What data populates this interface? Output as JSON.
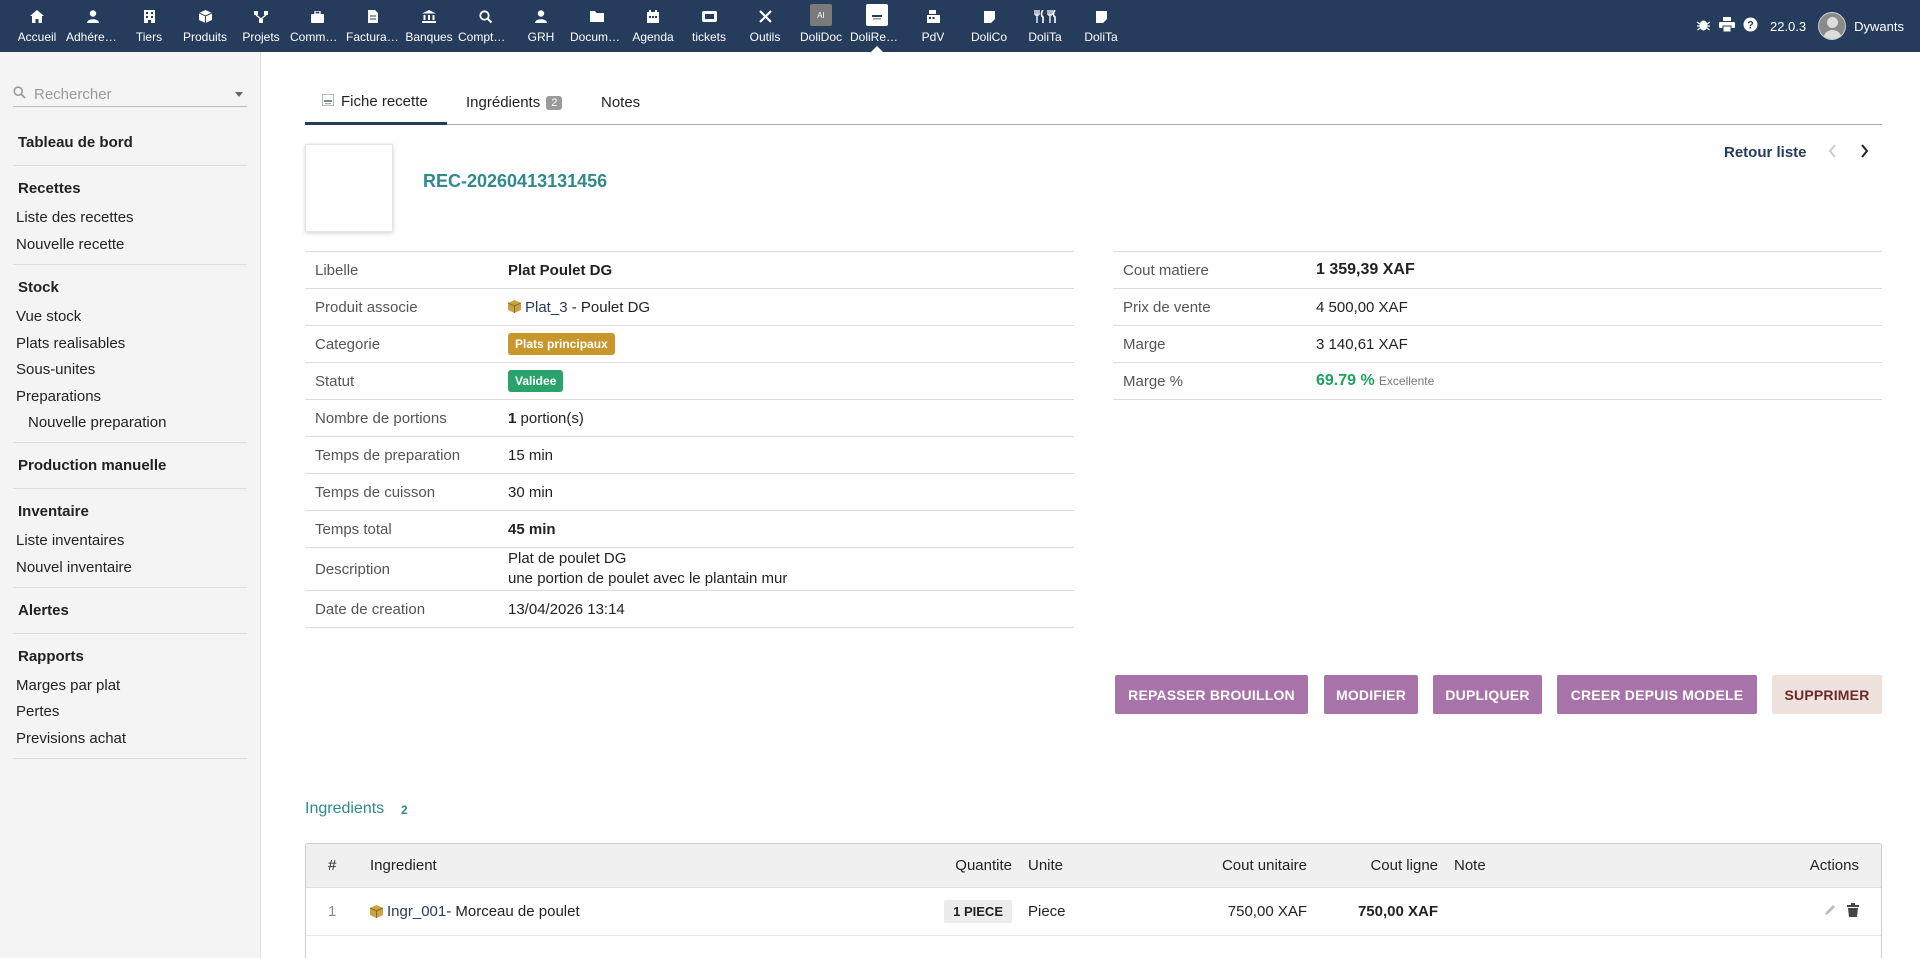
{
  "topmenu": [
    {
      "label": "Accueil",
      "icon": "home-icon"
    },
    {
      "label": "Adhérents",
      "icon": "member-icon"
    },
    {
      "label": "Tiers",
      "icon": "building-icon"
    },
    {
      "label": "Produits",
      "icon": "cube-icon"
    },
    {
      "label": "Projets",
      "icon": "project-icon"
    },
    {
      "label": "Commercial",
      "icon": "briefcase-icon"
    },
    {
      "label": "Facturation",
      "icon": "invoice-icon"
    },
    {
      "label": "Banques",
      "icon": "bank-icon"
    },
    {
      "label": "Comptabilité",
      "icon": "search-doc-icon"
    },
    {
      "label": "GRH",
      "icon": "user-tie-icon"
    },
    {
      "label": "Documents",
      "icon": "folder-icon"
    },
    {
      "label": "Agenda",
      "icon": "calendar-icon"
    },
    {
      "label": "tickets",
      "icon": "ticket-icon"
    },
    {
      "label": "Outils",
      "icon": "tools-icon"
    },
    {
      "label": "DoliDoc",
      "icon": "ai-box-icon"
    },
    {
      "label": "DoliRecettes",
      "icon": "recipe-box-icon"
    },
    {
      "label": "PdV",
      "icon": "cash-register-icon"
    },
    {
      "label": "DoliCo",
      "icon": "note-icon"
    },
    {
      "label": "DoliTa",
      "icon": "cutlery-icon"
    },
    {
      "label": "DoliTa",
      "icon": "note-icon"
    }
  ],
  "top_right": {
    "version": "22.0.3",
    "user": "Dywants"
  },
  "sidebar": {
    "search_placeholder": "Rechercher",
    "dashboard": "Tableau de bord",
    "recettes": {
      "title": "Recettes",
      "items": [
        "Liste des recettes",
        "Nouvelle recette"
      ]
    },
    "stock": {
      "title": "Stock",
      "items": [
        "Vue stock",
        "Plats realisables",
        "Sous-unites",
        "Preparations"
      ],
      "sub_item": "Nouvelle preparation"
    },
    "production": "Production manuelle",
    "inventaire": {
      "title": "Inventaire",
      "items": [
        "Liste inventaires",
        "Nouvel inventaire"
      ]
    },
    "alertes": "Alertes",
    "rapports": {
      "title": "Rapports",
      "items": [
        "Marges par plat",
        "Pertes",
        "Previsions achat"
      ]
    }
  },
  "tabs": [
    {
      "label": "Fiche recette"
    },
    {
      "label": "Ingrédients",
      "badge": "2"
    },
    {
      "label": "Notes"
    }
  ],
  "header": {
    "ref": "REC-20260413131456",
    "back": "Retour liste"
  },
  "fields_left": {
    "libelle": {
      "label": "Libelle",
      "value": "Plat Poulet DG"
    },
    "produit": {
      "label": "Produit associe",
      "ref": "Plat_3",
      "name": " - Poulet DG"
    },
    "categorie": {
      "label": "Categorie",
      "value": "Plats principaux"
    },
    "statut": {
      "label": "Statut",
      "value": "Validee"
    },
    "portions": {
      "label": "Nombre de portions",
      "number": "1",
      "unit": " portion(s)"
    },
    "prep": {
      "label": "Temps de preparation",
      "value": "15 min"
    },
    "cuisson": {
      "label": "Temps de cuisson",
      "value": "30 min"
    },
    "total": {
      "label": "Temps total",
      "value": "45 min"
    },
    "description": {
      "label": "Description",
      "line1": "Plat de poulet DG",
      "line2": "une portion de poulet avec le plantain mur"
    },
    "date": {
      "label": "Date de creation",
      "value": "13/04/2026 13:14"
    }
  },
  "fields_right": {
    "cout": {
      "label": "Cout matiere",
      "value": "1 359,39 XAF"
    },
    "prix": {
      "label": "Prix de vente",
      "value": "4 500,00 XAF"
    },
    "marge": {
      "label": "Marge",
      "value": "3 140,61 XAF"
    },
    "marge_pct": {
      "label": "Marge %",
      "value": "69.79 %",
      "note": "Excellente"
    }
  },
  "buttons": {
    "brouillon": "REPASSER BROUILLON",
    "modifier": "MODIFIER",
    "dupliquer": "DUPLIQUER",
    "creer": "CREER DEPUIS MODELE",
    "supprimer": "SUPPRIMER"
  },
  "ingredients": {
    "title": "Ingredients",
    "count": "2",
    "columns": {
      "num": "#",
      "ingredient": "Ingredient",
      "quantite": "Quantite",
      "unite": "Unite",
      "cout_unitaire": "Cout unitaire",
      "cout_ligne": "Cout ligne",
      "note": "Note",
      "actions": "Actions"
    },
    "rows": [
      {
        "num": "1",
        "ref": "Ingr_001",
        "name": " - Morceau de poulet",
        "qty": "1 PIECE",
        "unit": "Piece",
        "unit_cost": "750,00 XAF",
        "line_cost": "750,00 XAF",
        "note": ""
      }
    ]
  },
  "colors": {
    "topbar": "#263c5c",
    "accent_teal": "#2e8a8c",
    "button": "#a773a9",
    "category": "#c9962c",
    "status": "#2aa36b",
    "margin_green": "#1fa35b"
  }
}
